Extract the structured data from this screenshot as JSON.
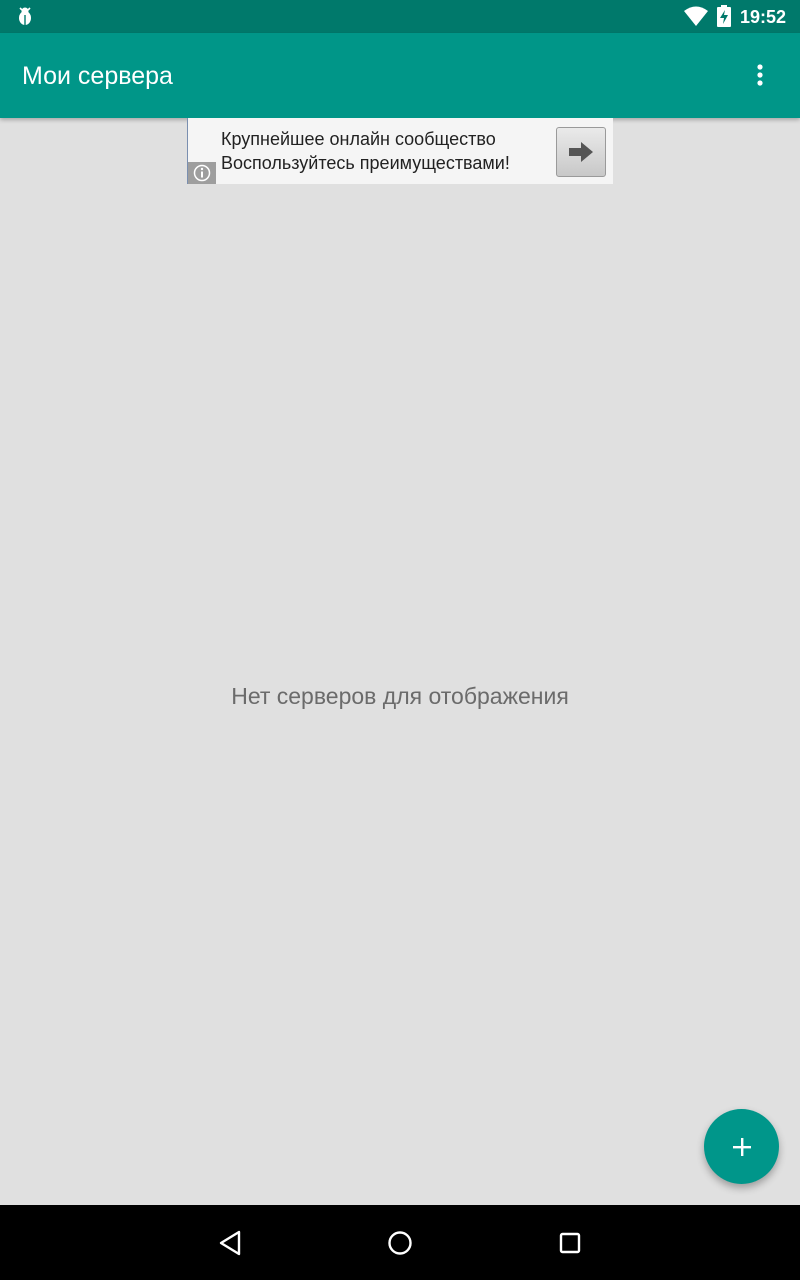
{
  "status_bar": {
    "time": "19:52",
    "icons": [
      "bug-icon",
      "wifi-icon",
      "battery-charging-icon"
    ]
  },
  "app_bar": {
    "title": "Мои сервера",
    "overflow_icon": "more-vert-icon"
  },
  "ad": {
    "line1": "Крупнейшее онлайн сообщество",
    "line2": "Воспользуйтесь преимуществами!",
    "info_icon": "info-icon",
    "arrow_icon": "arrow-right-icon"
  },
  "main": {
    "empty_message": "Нет серверов для отображения"
  },
  "fab": {
    "icon": "plus-icon"
  },
  "nav_bar": {
    "icons": [
      "back-icon",
      "home-icon",
      "recents-icon"
    ]
  },
  "colors": {
    "status_bar": "#00796b",
    "app_bar": "#009688",
    "background": "#e0e0e0",
    "fab": "#00968a"
  }
}
